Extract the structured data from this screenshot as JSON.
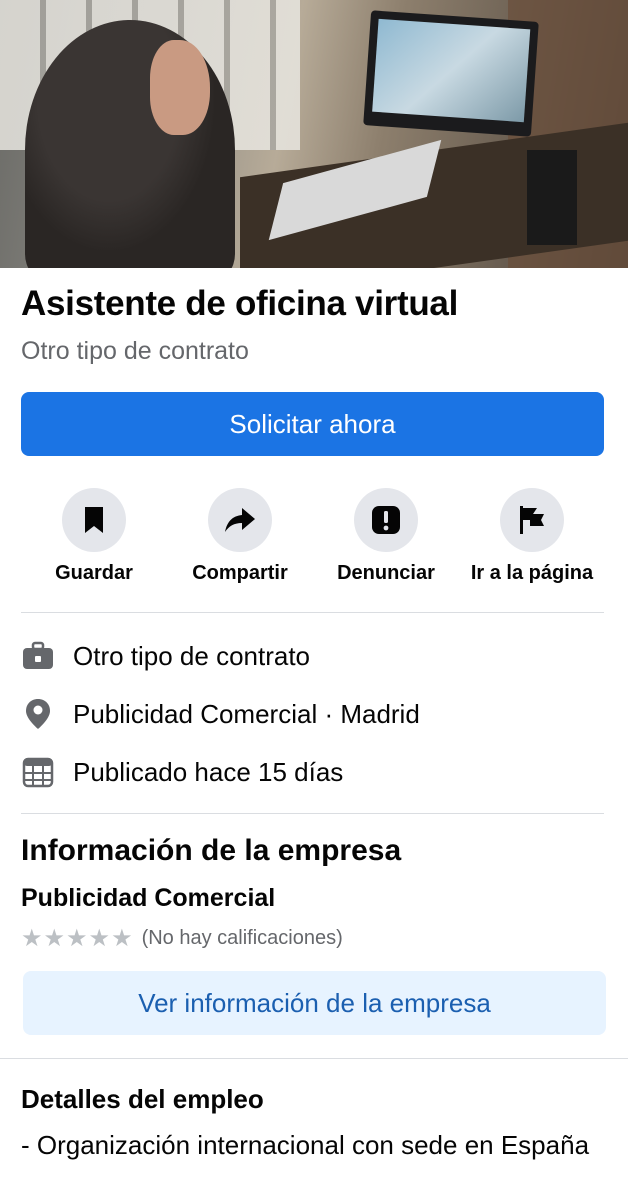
{
  "job": {
    "title": "Asistente de oficina virtual",
    "contract_type": "Otro tipo de contrato",
    "apply_label": "Solicitar ahora"
  },
  "actions": [
    {
      "label": "Guardar",
      "icon": "bookmark-icon"
    },
    {
      "label": "Compartir",
      "icon": "share-icon"
    },
    {
      "label": "Denunciar",
      "icon": "report-icon"
    },
    {
      "label": "Ir a la página",
      "icon": "flag-icon"
    }
  ],
  "info": {
    "contract": "Otro tipo de contrato",
    "location": "Publicidad Comercial · Madrid",
    "posted": "Publicado hace 15 días"
  },
  "company": {
    "section_title": "Información de la empresa",
    "name": "Publicidad Comercial",
    "rating_text": "(No hay calificaciones)",
    "stars": 5,
    "view_button": "Ver información de la empresa"
  },
  "details": {
    "section_title": "Detalles del empleo",
    "text": "- Organización internacional con sede en España"
  },
  "colors": {
    "primary": "#1b74e4",
    "secondary_text": "#65676b",
    "light_button_bg": "#e7f3ff",
    "light_button_text": "#1b5fb0",
    "icon_circle_bg": "#e4e6eb"
  }
}
